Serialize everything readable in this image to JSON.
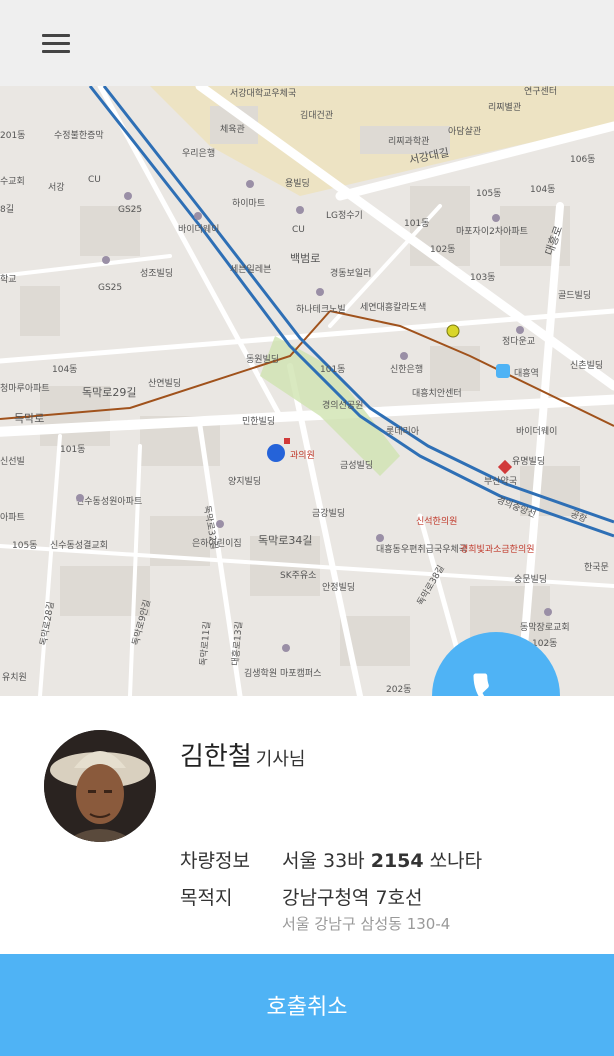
{
  "header": {
    "menu_icon": "hamburger-menu-icon"
  },
  "map": {
    "labels": {
      "lbl_0": "서강대학교우체국",
      "lbl_1": "김대건관",
      "lbl_2": "리찌과학관",
      "lbl_3": "아담샬관",
      "lbl_4": "리찌별관",
      "lbl_5": "연구센터",
      "lbl_6": "서강대길",
      "lbl_7": "체육관",
      "lbl_8": "우리은행",
      "lbl_9": "수정불한증막",
      "lbl_10": "용빌딩",
      "lbl_11": "하이마트",
      "lbl_12": "CU",
      "lbl_13": "GS25",
      "lbl_14": "바이더웨이",
      "lbl_15": "CU",
      "lbl_16": "LG정수기",
      "lbl_17": "101동",
      "lbl_18": "102동",
      "lbl_19": "105동",
      "lbl_20": "104동",
      "lbl_21": "106동",
      "lbl_22": "마포자이2차아파트",
      "lbl_23": "103동",
      "lbl_24": "골드빌딩",
      "lbl_25": "성조빌딩",
      "lbl_26": "세븐일레븐",
      "lbl_27": "경동보일러",
      "lbl_28": "GS25",
      "lbl_29": "하나테크노빌",
      "lbl_30": "세연대흥칼라도색",
      "lbl_31": "백범로",
      "lbl_32": "대흥로",
      "lbl_33": "정다운교",
      "lbl_34": "신촌빌딩",
      "lbl_35": "대흥역",
      "lbl_36": "동원빌딩",
      "lbl_37": "101동",
      "lbl_38": "신한은행",
      "lbl_39": "대흥치안센터",
      "lbl_40": "104동",
      "lbl_41": "청마루아파트",
      "lbl_42": "독막로29길",
      "lbl_43": "산연빌딩",
      "lbl_44": "경의선공원",
      "lbl_45": "롯데리아",
      "lbl_46": "바이더웨이",
      "lbl_47": "독막로",
      "lbl_48": "민한빌딩",
      "lbl_49": "101동",
      "lbl_50": "과의원",
      "lbl_51": "금성빌딩",
      "lbl_52": "유명빌딩",
      "lbl_53": "부산약국",
      "lbl_54": "신선빌",
      "lbl_55": "양지빌딩",
      "lbl_56": "신수동성원아파트",
      "lbl_57": "금강빌딩",
      "lbl_58": "신석한의원",
      "lbl_59": "105동",
      "lbl_60": "신수동성결교회",
      "lbl_61": "은하어린이집",
      "lbl_62": "독막로34길",
      "lbl_63": "대흥동우편취급국우체국",
      "lbl_64": "경희빛과소금한의원",
      "lbl_65": "SK주유소",
      "lbl_66": "안정빌딩",
      "lbl_67": "숭문빌딩",
      "lbl_68": "한국문",
      "lbl_69": "동막장로교회",
      "lbl_70": "102동",
      "lbl_71": "김생학원 마포캠퍼스",
      "lbl_72": "202동",
      "lbl_73": "유치원",
      "lbl_74": "독막로28길",
      "lbl_75": "독막로9안길",
      "lbl_76": "독막로11길",
      "lbl_77": "대흥로13길",
      "lbl_78": "독막로32길",
      "lbl_79": "독막로38길",
      "lbl_80": "경의중앙선",
      "lbl_81": "수교회",
      "lbl_82": "서강",
      "lbl_83": "아파트",
      "lbl_84": "학교",
      "lbl_85": "8길",
      "lbl_86": "201동",
      "lbl_87": "공항"
    }
  },
  "call_button": {
    "icon": "phone-icon"
  },
  "driver": {
    "name": "김한철",
    "suffix": "기사님",
    "vehicle_label": "차량정보",
    "vehicle_prefix": "서울 33바",
    "vehicle_number": "2154",
    "vehicle_model": "쏘나타",
    "destination_label": "목적지",
    "destination": "강남구청역 7호선",
    "destination_address": "서울 강남구 삼성동 130-4"
  },
  "cancel_button": {
    "label": "호출취소"
  },
  "colors": {
    "accent": "#4fb3f5",
    "route_blue": "#2e6fb5",
    "rail_brown": "#a0521c",
    "map_bg": "#eae7e3"
  }
}
